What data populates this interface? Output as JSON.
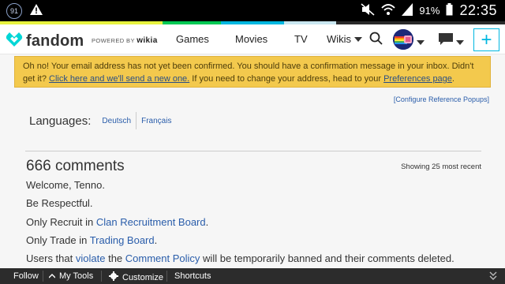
{
  "statusbar": {
    "notification_count": "91",
    "battery": "91%",
    "time": "22:35"
  },
  "colorstrip": [
    "#e7f33f",
    "#00c853",
    "#00b7e0",
    "#c9e6f0",
    "#2a2a2a"
  ],
  "navbar": {
    "logo_text": "fandom",
    "powered_prefix": "POWERED BY",
    "powered_brand": "wikia",
    "games": "Games",
    "movies": "Movies",
    "tv": "TV",
    "wikis": "Wikis"
  },
  "alert": {
    "text1": "Oh no! Your email address has not yet been confirmed. You should have a confirmation message in your inbox. Didn't get it?",
    "link1": "Click here and we'll send a new one.",
    "text2": "If you need to change your address, head to your",
    "link2": "Preferences page",
    "text3": "."
  },
  "config_popups": "[Configure Reference Popups]",
  "languages": {
    "label": "Languages:",
    "items": [
      "Deutsch",
      "Français"
    ]
  },
  "comments": {
    "title": "666 comments",
    "showing": "Showing 25 most recent",
    "welcome": "Welcome, Tenno.",
    "respectful": "Be Respectful.",
    "recruit_prefix": "Only Recruit in",
    "recruit_link": "Clan Recruitment Board",
    "recruit_suffix": ".",
    "trade_prefix": "Only Trade in",
    "trade_link": "Trading Board",
    "trade_suffix": ".",
    "violate_prefix": "Users that",
    "violate_link": "violate",
    "violate_mid": "the",
    "policy_link": "Comment Policy",
    "violate_suffix": "will be temporarily banned and their comments deleted."
  },
  "bottombar": {
    "follow": "Follow",
    "mytools": "My Tools",
    "customize": "Customize",
    "shortcuts": "Shortcuts"
  }
}
